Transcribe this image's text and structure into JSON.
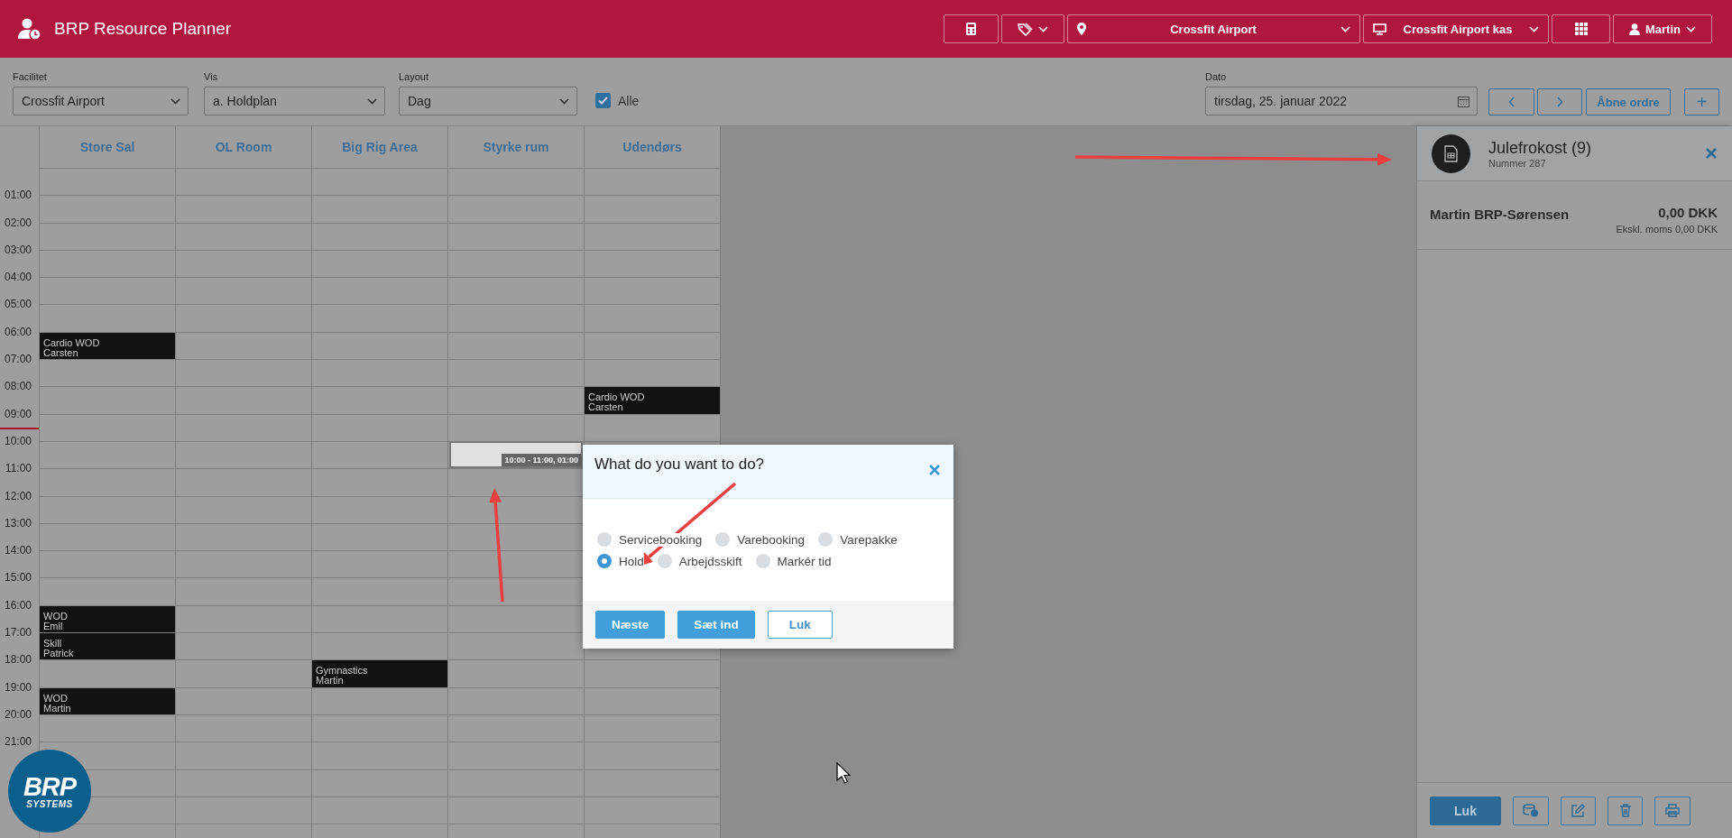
{
  "app": {
    "title": "BRP Resource Planner"
  },
  "header": {
    "location": "Crossfit Airport",
    "register": "Crossfit Airport kas",
    "user": "Martin"
  },
  "filters": {
    "facility": {
      "label": "Facilitet",
      "value": "Crossfit Airport"
    },
    "view": {
      "label": "Vis",
      "value": "a. Holdplan"
    },
    "layout": {
      "label": "Layout",
      "value": "Dag"
    },
    "all": {
      "label": "Alle",
      "checked": true
    },
    "date": {
      "label": "Dato",
      "value": "tirsdag, 25. januar 2022"
    },
    "open_orders": "Åbne ordre",
    "add": "+"
  },
  "calendar": {
    "resources": [
      "Store Sal",
      "OL Room",
      "Big Rig Area",
      "Styrke rum",
      "Udendørs"
    ],
    "rows": [
      {
        "cells": [
          {
            "kind": "free"
          },
          {
            "kind": "free"
          },
          {
            "kind": "free"
          },
          {
            "kind": "free"
          },
          {
            "kind": "free"
          }
        ]
      },
      {
        "label": "01:00",
        "cells": [
          {
            "kind": "free"
          },
          {
            "kind": "free"
          },
          {
            "kind": "free"
          },
          {
            "kind": "free"
          },
          {
            "kind": "free"
          }
        ]
      },
      {
        "label": "02:00",
        "cells": [
          {
            "kind": "free"
          },
          {
            "kind": "free"
          },
          {
            "kind": "free"
          },
          {
            "kind": "free"
          },
          {
            "kind": "free"
          }
        ]
      },
      {
        "label": "03:00",
        "cells": [
          {
            "kind": "free"
          },
          {
            "kind": "free"
          },
          {
            "kind": "free"
          },
          {
            "kind": "free"
          },
          {
            "kind": "free"
          }
        ]
      },
      {
        "label": "04:00",
        "cells": [
          {
            "kind": "free"
          },
          {
            "kind": "free"
          },
          {
            "kind": "free"
          },
          {
            "kind": "free"
          },
          {
            "kind": "free"
          }
        ]
      },
      {
        "label": "05:00",
        "cells": [
          {
            "kind": "free"
          },
          {
            "kind": "free"
          },
          {
            "kind": "free"
          },
          {
            "kind": "free"
          },
          {
            "kind": "free"
          }
        ]
      },
      {
        "label": "06:00",
        "cells": [
          {
            "kind": "event",
            "title": "Cardio WOD",
            "person": "Carsten"
          },
          {
            "kind": "free"
          },
          {
            "kind": "free"
          },
          {
            "kind": "free"
          },
          {
            "kind": "free"
          }
        ]
      },
      {
        "label": "07:00",
        "cells": [
          {
            "kind": "free"
          },
          {
            "kind": "free"
          },
          {
            "kind": "free"
          },
          {
            "kind": "free"
          },
          {
            "kind": "free"
          }
        ]
      },
      {
        "label": "08:00",
        "cells": [
          {
            "kind": "free"
          },
          {
            "kind": "free"
          },
          {
            "kind": "free"
          },
          {
            "kind": "free"
          },
          {
            "kind": "event",
            "title": "Cardio WOD",
            "person": "Carsten"
          }
        ]
      },
      {
        "label": "09:00",
        "cells": [
          {
            "kind": "free"
          },
          {
            "kind": "free"
          },
          {
            "kind": "free"
          },
          {
            "kind": "free"
          },
          {
            "kind": "free"
          }
        ]
      },
      {
        "label": "10:00",
        "cells": [
          {
            "kind": "free"
          },
          {
            "kind": "free"
          },
          {
            "kind": "free"
          },
          {
            "kind": "selection",
            "label": "10:00 - 11:00, 01:00"
          },
          {
            "kind": "free"
          }
        ]
      },
      {
        "label": "11:00",
        "cells": [
          {
            "kind": "free"
          },
          {
            "kind": "free"
          },
          {
            "kind": "free"
          },
          {
            "kind": "free"
          },
          {
            "kind": "free"
          }
        ]
      },
      {
        "label": "12:00",
        "cells": [
          {
            "kind": "free"
          },
          {
            "kind": "free"
          },
          {
            "kind": "free"
          },
          {
            "kind": "free"
          },
          {
            "kind": "free"
          }
        ]
      },
      {
        "label": "13:00",
        "cells": [
          {
            "kind": "free"
          },
          {
            "kind": "free"
          },
          {
            "kind": "free"
          },
          {
            "kind": "free"
          },
          {
            "kind": "free"
          }
        ]
      },
      {
        "label": "14:00",
        "cells": [
          {
            "kind": "free"
          },
          {
            "kind": "free"
          },
          {
            "kind": "free"
          },
          {
            "kind": "free"
          },
          {
            "kind": "free"
          }
        ]
      },
      {
        "label": "15:00",
        "cells": [
          {
            "kind": "free"
          },
          {
            "kind": "free"
          },
          {
            "kind": "free"
          },
          {
            "kind": "free"
          },
          {
            "kind": "free"
          }
        ]
      },
      {
        "label": "16:00",
        "cells": [
          {
            "kind": "event",
            "title": "WOD",
            "person": "Emil"
          },
          {
            "kind": "free"
          },
          {
            "kind": "free"
          },
          {
            "kind": "free"
          },
          {
            "kind": "free"
          }
        ]
      },
      {
        "label": "17:00",
        "cells": [
          {
            "kind": "event",
            "title": "Skill",
            "person": "Patrick"
          },
          {
            "kind": "free"
          },
          {
            "kind": "free"
          },
          {
            "kind": "free"
          },
          {
            "kind": "free"
          }
        ]
      },
      {
        "label": "18:00",
        "cells": [
          {
            "kind": "free"
          },
          {
            "kind": "free"
          },
          {
            "kind": "event",
            "title": "Gymnastics",
            "person": "Martin"
          },
          {
            "kind": "free"
          },
          {
            "kind": "free"
          }
        ]
      },
      {
        "label": "19:00",
        "cells": [
          {
            "kind": "event",
            "title": "WOD",
            "person": "Martin"
          },
          {
            "kind": "free"
          },
          {
            "kind": "free"
          },
          {
            "kind": "free"
          },
          {
            "kind": "free"
          }
        ]
      },
      {
        "label": "20:00",
        "cells": [
          {
            "kind": "free"
          },
          {
            "kind": "free"
          },
          {
            "kind": "free"
          },
          {
            "kind": "free"
          },
          {
            "kind": "free"
          }
        ]
      },
      {
        "label": "21:00",
        "cells": [
          {
            "kind": "free"
          },
          {
            "kind": "free"
          },
          {
            "kind": "free"
          },
          {
            "kind": "free"
          },
          {
            "kind": "free"
          }
        ]
      },
      {
        "cells": [
          {
            "kind": "free"
          },
          {
            "kind": "free"
          },
          {
            "kind": "free"
          },
          {
            "kind": "free"
          },
          {
            "kind": "free"
          }
        ]
      },
      {
        "cells": [
          {
            "kind": "free"
          },
          {
            "kind": "free"
          },
          {
            "kind": "free"
          },
          {
            "kind": "free"
          },
          {
            "kind": "free"
          }
        ]
      }
    ]
  },
  "dialog": {
    "title": "What do you want to do?",
    "options": [
      {
        "label": "Servicebooking",
        "selected": false
      },
      {
        "label": "Varebooking",
        "selected": false
      },
      {
        "label": "Varepakke",
        "selected": false
      },
      {
        "label": "Hold",
        "selected": true
      },
      {
        "label": "Arbejdsskift",
        "selected": false
      },
      {
        "label": "Markér tid",
        "selected": false
      }
    ],
    "buttons": [
      {
        "label": "Næste",
        "kind": "primary"
      },
      {
        "label": "Sæt ind",
        "kind": "primary"
      },
      {
        "label": "Luk",
        "kind": "outline"
      }
    ]
  },
  "order_panel": {
    "title": "Julefrokost (9)",
    "number": "Nummer 287",
    "lines": [
      {
        "name": "Martin BRP-Sørensen",
        "total": "0,00 DKK",
        "net": "Ekskl. moms 0,00 DKK"
      }
    ],
    "close_button": "Luk"
  },
  "logo": {
    "brand": "BRP",
    "sub": "SYSTEMS"
  }
}
